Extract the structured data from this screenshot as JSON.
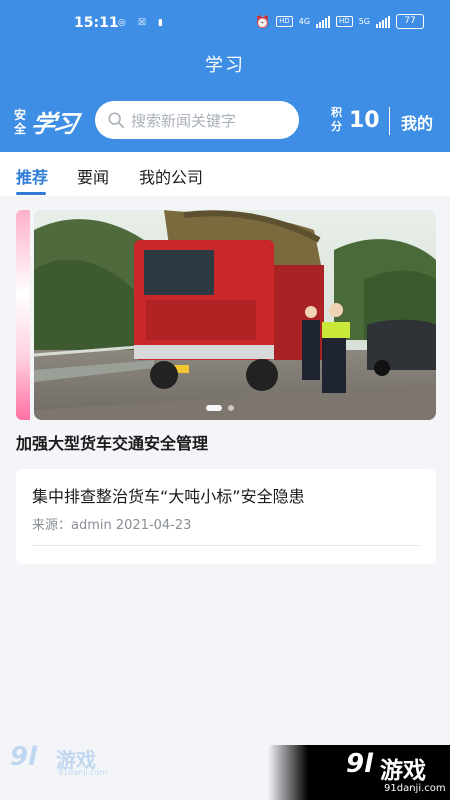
{
  "status_bar": {
    "time": "15:11",
    "left_icons": [
      "notification-icon",
      "app-icon",
      "record-icon"
    ],
    "right_badges": [
      "HD",
      "4G",
      "HD",
      "5G"
    ],
    "battery": "77"
  },
  "header": {
    "title": "学习",
    "logo_small": "安全",
    "logo_big": "学习",
    "search_placeholder": "搜索新闻关键字",
    "points_label": "积分",
    "points_value": "10",
    "mine_label": "我的"
  },
  "tabs": [
    {
      "label": "推荐",
      "active": true
    },
    {
      "label": "要闻",
      "active": false
    },
    {
      "label": "我的公司",
      "active": false
    }
  ],
  "banner": {
    "caption": "加强大型货车交通安全管理",
    "slide_count": 2,
    "active_slide": 1
  },
  "news": [
    {
      "title": "集中排查整治货车“大吨小标”安全隐患",
      "meta": "来源：admin  2021-04-23"
    }
  ],
  "watermark": {
    "brand_num": "9l",
    "brand_cn": "游戏",
    "url": "91danji.com"
  },
  "colors": {
    "header_bg": "#3e8ee6",
    "accent": "#2f7bd6",
    "page_bg": "#f3f5f9"
  }
}
